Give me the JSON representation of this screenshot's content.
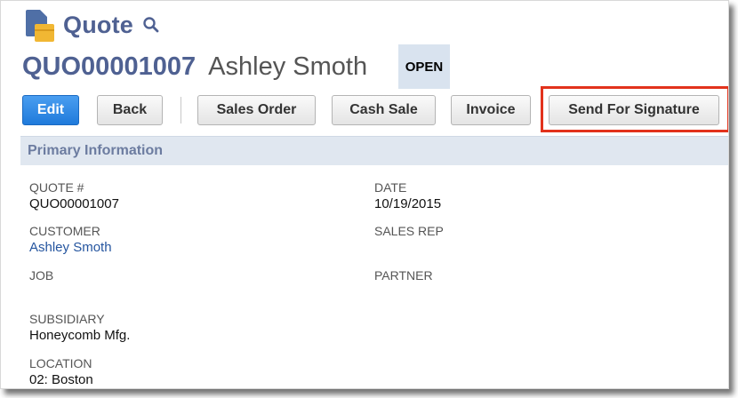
{
  "header": {
    "title": "Quote",
    "icon": "quote-record-icon",
    "search_icon": "search-icon"
  },
  "record": {
    "number": "QUO00001007",
    "name": "Ashley Smoth",
    "status": "OPEN"
  },
  "toolbar": {
    "edit_label": "Edit",
    "back_label": "Back",
    "sales_order_label": "Sales Order",
    "cash_sale_label": "Cash Sale",
    "invoice_label": "Invoice",
    "send_for_signature_label": "Send For Signature"
  },
  "section": {
    "title": "Primary Information"
  },
  "fields": {
    "quote_number": {
      "label": "QUOTE #",
      "value": "QUO00001007"
    },
    "date": {
      "label": "DATE",
      "value": "10/19/2015"
    },
    "customer": {
      "label": "CUSTOMER",
      "value": "Ashley Smoth"
    },
    "sales_rep": {
      "label": "SALES REP",
      "value": ""
    },
    "job": {
      "label": "JOB",
      "value": ""
    },
    "partner": {
      "label": "PARTNER",
      "value": ""
    },
    "subsidiary": {
      "label": "SUBSIDIARY",
      "value": "Honeycomb Mfg."
    },
    "location": {
      "label": "LOCATION",
      "value": "02: Boston"
    }
  },
  "colors": {
    "heading": "#4f6192",
    "primary_button": "#2a86e6",
    "highlight": "#e2321c",
    "section_bar": "#e0e7f0",
    "link": "#25559f"
  }
}
